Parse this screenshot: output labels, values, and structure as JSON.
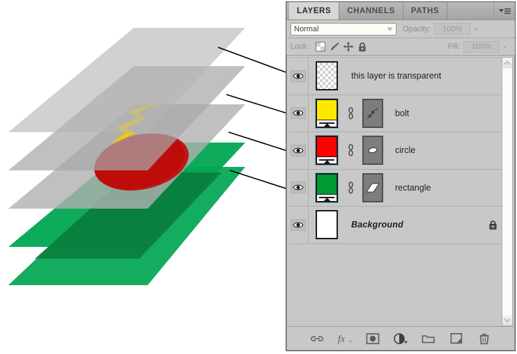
{
  "panel": {
    "tabs": [
      {
        "label": "LAYERS",
        "active": true
      },
      {
        "label": "CHANNELS",
        "active": false
      },
      {
        "label": "PATHS",
        "active": false
      }
    ],
    "menu_icon": "panel-menu-icon",
    "blend_mode": {
      "value": "Normal",
      "dropdown_icon": "chevron-down-icon"
    },
    "opacity": {
      "label": "Opacity:",
      "value": "100%",
      "stepper_icon": "chevron-right-icon"
    },
    "lock": {
      "label": "Lock:",
      "icons": [
        "lock-transparency-icon",
        "lock-image-icon",
        "lock-position-icon",
        "lock-all-icon"
      ]
    },
    "fill": {
      "label": "Fill:",
      "value": "100%",
      "stepper_icon": "chevron-right-icon"
    },
    "scrollbar": {
      "up_icon": "chevron-up-icon",
      "down_icon": "chevron-down-icon"
    },
    "footer_buttons": [
      {
        "name": "link-layers-icon",
        "label": "link"
      },
      {
        "name": "layer-styles-fx-icon",
        "label": "fx"
      },
      {
        "name": "add-layer-mask-icon",
        "label": "mask"
      },
      {
        "name": "adjustment-layer-icon",
        "label": "adjustment"
      },
      {
        "name": "new-group-folder-icon",
        "label": "group"
      },
      {
        "name": "new-layer-icon",
        "label": "new layer"
      },
      {
        "name": "delete-layer-trash-icon",
        "label": "delete"
      }
    ]
  },
  "layers": [
    {
      "name": "this layer is transparent",
      "visible": true,
      "thumb_type": "checker",
      "thumb_color": "",
      "has_mask": false,
      "has_link": false,
      "locked": false,
      "italic": false
    },
    {
      "name": "bolt",
      "visible": true,
      "thumb_type": "color",
      "thumb_color": "#FFE800",
      "has_mask": true,
      "mask_shape": "bolt-mask-shape",
      "has_link": true,
      "locked": false,
      "italic": false
    },
    {
      "name": "circle",
      "visible": true,
      "thumb_type": "color",
      "thumb_color": "#FF0000",
      "has_mask": true,
      "mask_shape": "circle-mask-shape",
      "has_link": true,
      "locked": false,
      "italic": false
    },
    {
      "name": "rectangle",
      "visible": true,
      "thumb_type": "color",
      "thumb_color": "#009933",
      "has_mask": true,
      "mask_shape": "rectangle-mask-shape",
      "has_link": true,
      "locked": false,
      "italic": false
    },
    {
      "name": "Background",
      "visible": true,
      "thumb_type": "solid-white",
      "thumb_color": "#FFFFFF",
      "has_mask": false,
      "has_link": false,
      "locked": true,
      "italic": true
    }
  ],
  "illustration": {
    "description": "Exploded 3D view of four stacked transparent layer planes above a white background plane",
    "planes": [
      {
        "name": "plane-transparent-top",
        "color": "#B4B4B4",
        "opacity": 0.85
      },
      {
        "name": "plane-bolt",
        "color": "#B4B4B4",
        "opacity": 0.85,
        "artwork": "yellow-lightning-bolt"
      },
      {
        "name": "plane-circle",
        "color": "#B4B4B4",
        "opacity": 0.85,
        "artwork": "red-ellipse"
      },
      {
        "name": "plane-rectangle",
        "color": "#00A651",
        "opacity": 1,
        "artwork": "green-rectangle"
      }
    ],
    "artwork_colors": {
      "bolt": "#F5D000",
      "circle": "#C20000",
      "rectangle": "#00A651",
      "plane_gray": "#B0B0B0"
    },
    "connector_lines": 4
  }
}
